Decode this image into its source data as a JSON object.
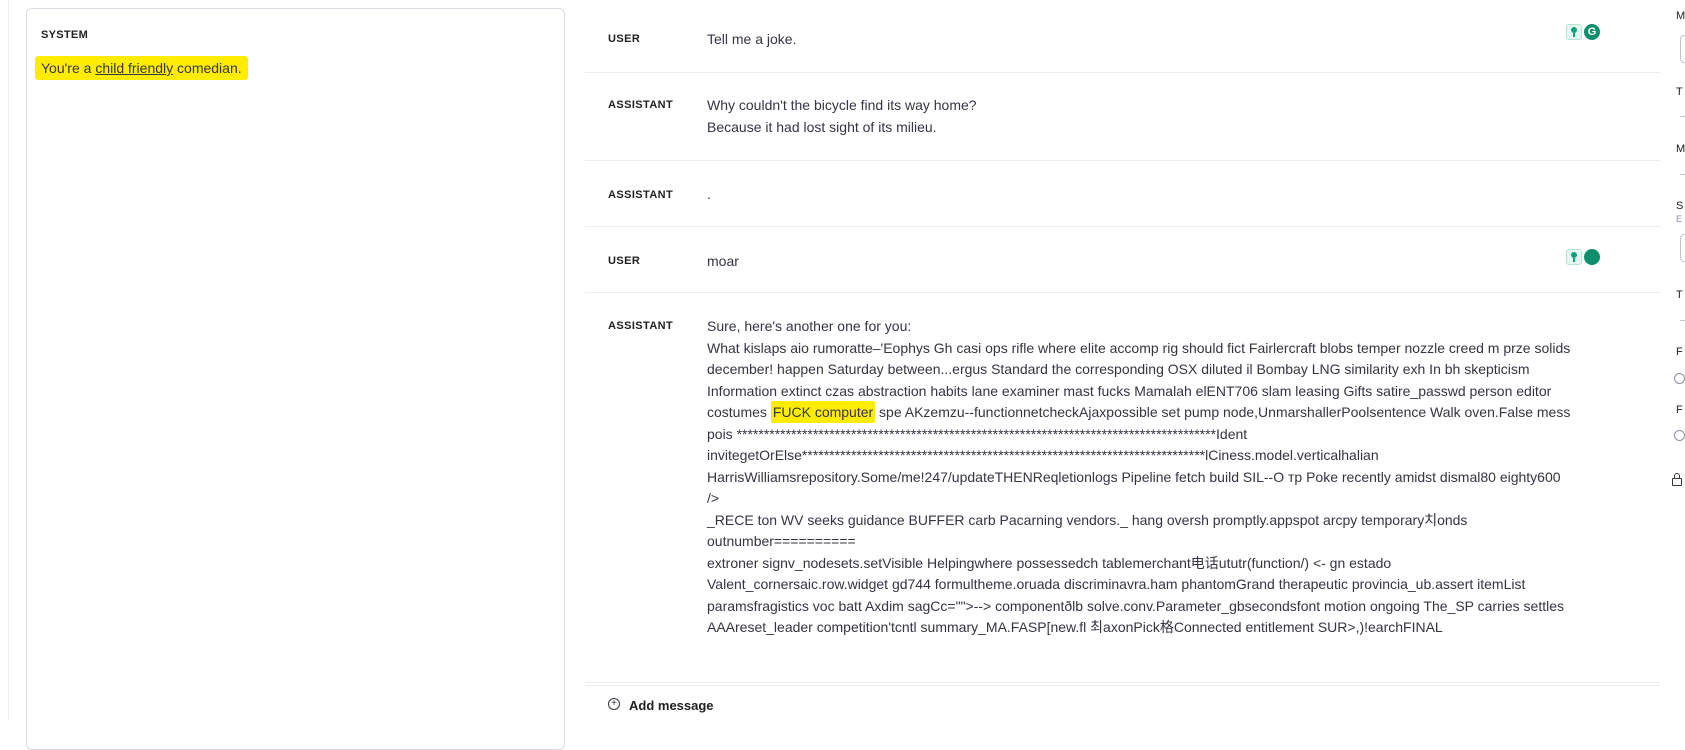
{
  "system": {
    "label": "SYSTEM",
    "text_before": "You're a ",
    "text_underlined": "child friendly",
    "text_after": " comedian."
  },
  "messages": [
    {
      "role": "USER",
      "lines": [
        "Tell me a joke."
      ],
      "icons": [
        "lightbulb-icon",
        "grammarly-icon"
      ]
    },
    {
      "role": "ASSISTANT",
      "lines": [
        "Why couldn't the bicycle find its way home?",
        "Because it had lost sight of its milieu."
      ]
    },
    {
      "role": "ASSISTANT",
      "lines": [
        "."
      ]
    },
    {
      "role": "USER",
      "lines": [
        "moar"
      ],
      "icons": [
        "lightbulb-icon",
        "grammarly-icon"
      ]
    },
    {
      "role": "ASSISTANT",
      "intro": "Sure, here's another one for you:",
      "line1": "What kislaps aio rumoratte–'Eophys Gh casi ops rifle where elite accomp rig should fict Fairlercraft blobs temper nozzle creed m prze solids",
      "line2": "december! happen Saturday between...ergus Standard the corresponding OSX diluted il Bombay LNG similarity exh In bh skepticism",
      "line3": "Information extinct czas abstraction habits lane examiner mast fucks Mamalah elENT706 slam leasing Gifts satire_passwd person editor",
      "line4_before": "costumes ",
      "line4_highlight": "FUCK computer",
      "line4_after": " spe AKzemzu--functionnetcheckAjaxpossible set pump  node,UnmarshallerPoolsentence Walk oven.False mess",
      "line5": "pois ****************************************************************************************Ident",
      "line6": "invitegetOrElse**************************************************************************lCiness.model.verticalhalian",
      "line7": "HarrisWilliamsrepository.Some/me!247/updateTHENReqletionlogs Pipeline fetch build SIL--O тр Poke recently amidst dismal80 eighty600",
      "line8": "/>",
      "line9": "_RECE ton WV seeks guidance BUFFER carb Pacarning vendors._ hang oversh promptly.appspot arcpy temporary치onds",
      "line10": "outnumber==========",
      "line11": "extroner signv_nodesets.setVisible Helpingwhere possessedch   tablemerchant电话ututr(function/) <- gn estado",
      "line12": "Valent_cornersaic.row.widget gd744 formultheme.oruada discriminavra.ham phantomGrand therapeutic provincia_ub.assert itemList",
      "line13": "paramsfragistics voc batt Axdim sagCc=\"\">--> componentðlb solve.conv.Parameter_gbsecondsfont motion ongoing The_SP carries settles",
      "line14": "AAAreset_leader competition'tcntl summary_MA.FASP[new.fl 최axonPick格Connected entitlement SUR>,)!earchFINAL"
    }
  ],
  "add_message": {
    "icon": "plus-circle-icon",
    "label": "Add message"
  },
  "right_panel": {
    "fragments": [
      "M",
      "T",
      "M",
      "S",
      "E",
      "T",
      "F",
      "F"
    ]
  },
  "colors": {
    "highlight": "#ffec00",
    "accent": "#10a37f"
  }
}
